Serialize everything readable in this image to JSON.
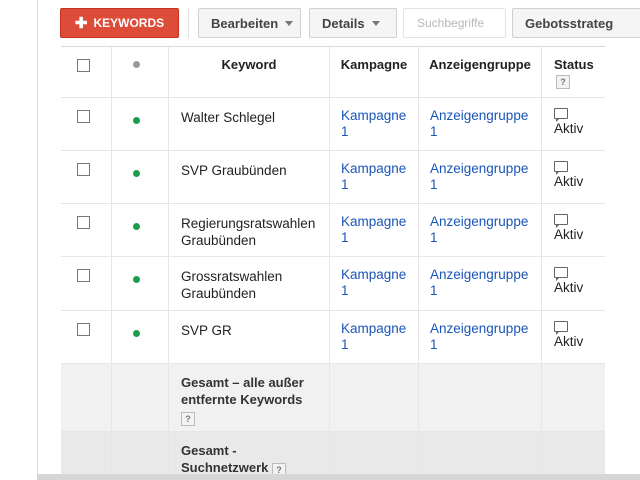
{
  "toolbar": {
    "add_keywords": "KEYWORDS",
    "edit": "Bearbeiten",
    "details": "Details",
    "search_terms": "Suchbegriffe",
    "bid_strategy": "Gebotsstrateg"
  },
  "table": {
    "headers": {
      "keyword": "Keyword",
      "campaign": "Kampagne",
      "ad_group": "Anzeigengruppe",
      "status": "Status"
    },
    "rows": [
      {
        "keyword": "Walter Schlegel",
        "campaign": "Kampagne 1",
        "ad_group": "Anzeigengruppe 1",
        "status": "Aktiv"
      },
      {
        "keyword": "SVP Graubünden",
        "campaign": "Kampagne 1",
        "ad_group": "Anzeigengruppe 1",
        "status": "Aktiv"
      },
      {
        "keyword": "Regierungsratswahlen Graubünden",
        "campaign": "Kampagne 1",
        "ad_group": "Anzeigengruppe 1",
        "status": "Aktiv"
      },
      {
        "keyword": "Grossratswahlen Graubünden",
        "campaign": "Kampagne 1",
        "ad_group": "Anzeigengruppe 1",
        "status": "Aktiv"
      },
      {
        "keyword": "SVP GR",
        "campaign": "Kampagne 1",
        "ad_group": "Anzeigengruppe 1",
        "status": "Aktiv"
      }
    ],
    "totals": {
      "all_except_removed": "Gesamt – alle außer entfernte Keywords",
      "search_network": "Gesamt - Suchnetzwerk"
    },
    "help_mark": "?"
  },
  "colors": {
    "primary_button": "#dd4b39",
    "link": "#1a55b8",
    "status_dot_active": "#1a9d4a"
  }
}
